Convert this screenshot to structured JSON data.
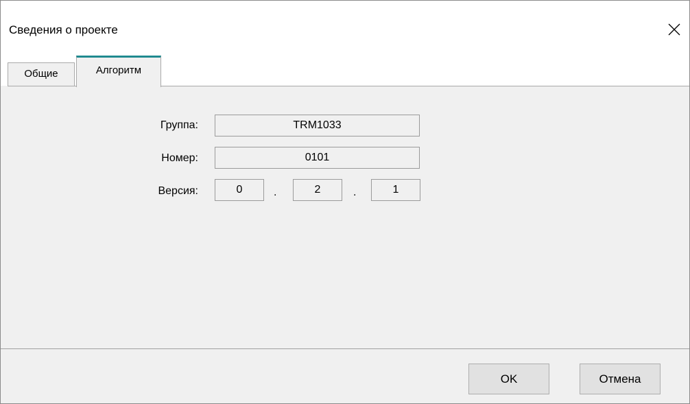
{
  "window": {
    "title": "Сведения о проекте",
    "close_icon": "close-icon"
  },
  "tabs": [
    {
      "label": "Общие",
      "active": false
    },
    {
      "label": "Алгоритм",
      "active": true
    }
  ],
  "form": {
    "group_label": "Группа:",
    "group_value": "TRM1033",
    "number_label": "Номер:",
    "number_value": "0101",
    "version_label": "Версия:",
    "version_major": "0",
    "version_minor": "2",
    "version_patch": "1",
    "version_separator": "."
  },
  "buttons": {
    "ok_label": "OK",
    "cancel_label": "Отмена"
  },
  "colors": {
    "active_tab_accent": "#1f8a8f",
    "dialog_background": "#f0f0f0"
  }
}
